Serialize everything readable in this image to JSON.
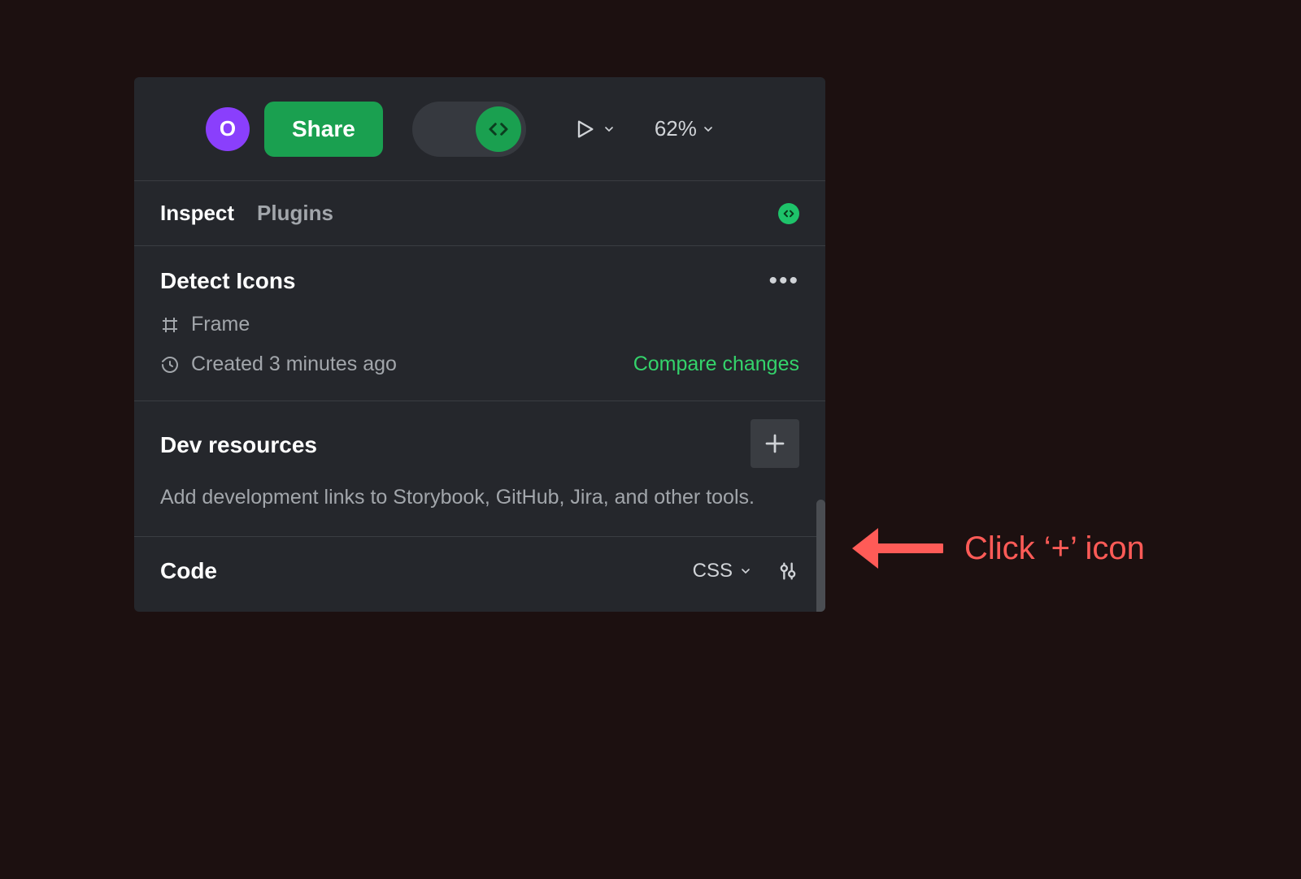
{
  "topbar": {
    "avatar_initial": "O",
    "share_label": "Share",
    "zoom_value": "62%"
  },
  "tabs": {
    "inspect": "Inspect",
    "plugins": "Plugins"
  },
  "detect_icons": {
    "title": "Detect Icons",
    "frame_label": "Frame",
    "created_label": "Created 3 minutes ago",
    "compare_label": "Compare changes"
  },
  "dev_resources": {
    "title": "Dev resources",
    "description": "Add development links to Storybook, GitHub, Jira, and other tools."
  },
  "code": {
    "title": "Code",
    "language": "CSS"
  },
  "callout": {
    "text": "Click ‘+’ icon"
  }
}
